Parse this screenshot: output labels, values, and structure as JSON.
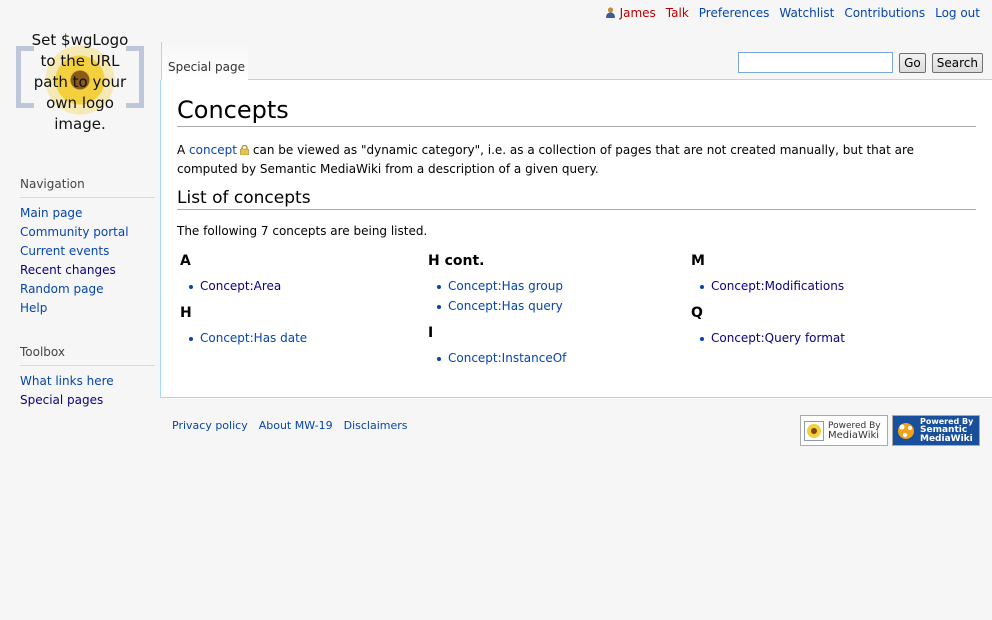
{
  "personal": {
    "user": "James",
    "talk": "Talk",
    "preferences": "Preferences",
    "watchlist": "Watchlist",
    "contributions": "Contributions",
    "logout": "Log out"
  },
  "logo": {
    "lines": [
      "Set $wgLogo",
      "to the URL",
      "path to your",
      "own logo",
      "image."
    ]
  },
  "navigation": {
    "heading": "Navigation",
    "items": [
      "Main page",
      "Community portal",
      "Current events",
      "Recent changes",
      "Random page",
      "Help"
    ]
  },
  "toolbox": {
    "heading": "Toolbox",
    "items": [
      "What links here",
      "Special pages"
    ]
  },
  "tab": {
    "label": "Special page"
  },
  "search": {
    "value": "",
    "go": "Go",
    "search": "Search"
  },
  "content": {
    "title": "Concepts",
    "intro_a": "A",
    "intro_link": "concept",
    "intro_rest": "can be viewed as \"dynamic category\", i.e. as a collection of pages that are not created manually, but that are computed by Semantic MediaWiki from a description of a given query.",
    "list_heading": "List of concepts",
    "count_text": "The following 7 concepts are being listed.",
    "columns": [
      {
        "groups": [
          {
            "letter": "A",
            "items": [
              "Concept:Area"
            ]
          },
          {
            "letter": "H",
            "items": [
              "Concept:Has date"
            ]
          }
        ]
      },
      {
        "groups": [
          {
            "letter": "H cont.",
            "items": [
              "Concept:Has group",
              "Concept:Has query"
            ]
          },
          {
            "letter": "I",
            "items": [
              "Concept:InstanceOf"
            ]
          }
        ]
      },
      {
        "groups": [
          {
            "letter": "M",
            "items": [
              "Concept:Modifications"
            ]
          },
          {
            "letter": "Q",
            "items": [
              "Concept:Query format"
            ]
          }
        ]
      }
    ]
  },
  "footer": {
    "links": [
      "Privacy policy",
      "About MW-19",
      "Disclaimers"
    ],
    "badge_mw": [
      "Powered By",
      "MediaWiki"
    ],
    "badge_smw": [
      "Powered By",
      "Semantic",
      "MediaWiki"
    ]
  },
  "colors": {
    "link": "#0645ad",
    "visited": "#0b0080",
    "new": "#ba0000",
    "border": "#a7d7f9"
  }
}
